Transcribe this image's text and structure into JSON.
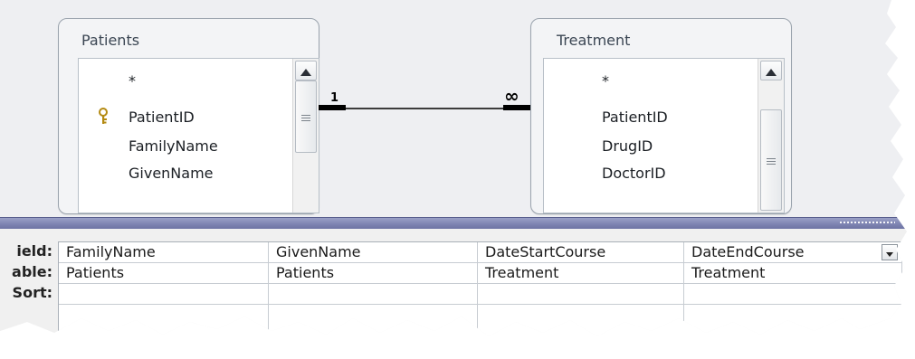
{
  "tables": [
    {
      "title": "Patients",
      "fields": [
        "*",
        "PatientID",
        "FamilyName",
        "GivenName"
      ],
      "primary_key": "PatientID"
    },
    {
      "title": "Treatment",
      "fields": [
        "*",
        "PatientID",
        "DrugID",
        "DoctorID"
      ]
    }
  ],
  "relationship": {
    "one_label": "1",
    "many_label": "∞"
  },
  "grid": {
    "row_labels": [
      "ield:",
      "able:",
      "Sort:"
    ],
    "columns": [
      {
        "field": "FamilyName",
        "table": "Patients",
        "sort": ""
      },
      {
        "field": "GivenName",
        "table": "Patients",
        "sort": ""
      },
      {
        "field": "DateStartCourse",
        "table": "Treatment",
        "sort": ""
      },
      {
        "field": "DateEndCourse",
        "table": "Treatment",
        "sort": ""
      }
    ]
  },
  "icons": {
    "key": "key-icon",
    "scroll_up": "triangle-up-icon",
    "scroll_grip": "grip-lines-icon",
    "dropdown": "chevron-down-icon"
  },
  "colors": {
    "design_background": "#eeeff2",
    "splitter": "#7d83b1",
    "key_gold": "#c9a227"
  }
}
